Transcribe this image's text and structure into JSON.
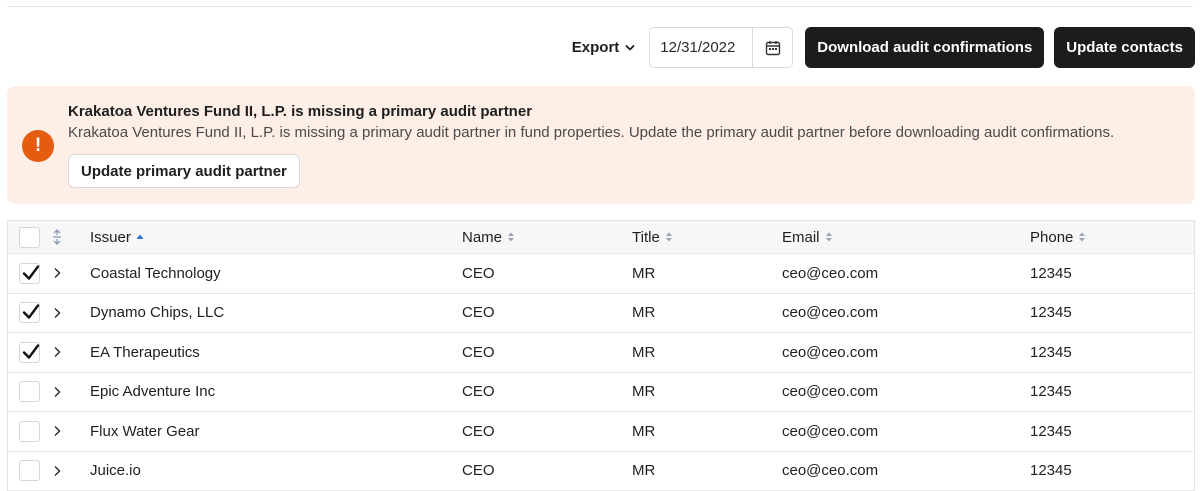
{
  "toolbar": {
    "export_label": "Export",
    "date_value": "12/31/2022",
    "download_label": "Download audit confirmations",
    "update_contacts_label": "Update contacts"
  },
  "alert": {
    "icon_glyph": "!",
    "title": "Krakatoa Ventures Fund II, L.P. is missing a primary audit partner",
    "message": "Krakatoa Ventures Fund II, L.P. is missing a primary audit partner in fund properties. Update the primary audit partner before downloading audit confirmations.",
    "button_label": "Update primary audit partner",
    "accent_color": "#e65c0f",
    "background_color": "#fdeee6"
  },
  "table": {
    "columns": {
      "issuer": "Issuer",
      "name": "Name",
      "title": "Title",
      "email": "Email",
      "phone": "Phone"
    },
    "sort": {
      "column": "issuer",
      "direction": "asc"
    },
    "rows": [
      {
        "checked": true,
        "issuer": "Coastal Technology",
        "name": "CEO",
        "title": "MR",
        "email": "ceo@ceo.com",
        "phone": "12345"
      },
      {
        "checked": true,
        "issuer": "Dynamo Chips, LLC",
        "name": "CEO",
        "title": "MR",
        "email": "ceo@ceo.com",
        "phone": "12345"
      },
      {
        "checked": true,
        "issuer": "EA Therapeutics",
        "name": "CEO",
        "title": "MR",
        "email": "ceo@ceo.com",
        "phone": "12345"
      },
      {
        "checked": false,
        "issuer": "Epic Adventure Inc",
        "name": "CEO",
        "title": "MR",
        "email": "ceo@ceo.com",
        "phone": "12345"
      },
      {
        "checked": false,
        "issuer": "Flux Water Gear",
        "name": "CEO",
        "title": "MR",
        "email": "ceo@ceo.com",
        "phone": "12345"
      },
      {
        "checked": false,
        "issuer": "Juice.io",
        "name": "CEO",
        "title": "MR",
        "email": "ceo@ceo.com",
        "phone": "12345"
      }
    ]
  },
  "icons": {
    "export_dropdown": "chevron-down-icon",
    "date_picker": "calendar-icon",
    "alert": "exclamation-icon",
    "expand_all": "expand-collapse-icon",
    "row_expand": "chevron-right-icon",
    "sort_asc": "sort-asc-icon",
    "sort_none": "sort-icon",
    "checkbox_checked": "checkmark-icon"
  }
}
